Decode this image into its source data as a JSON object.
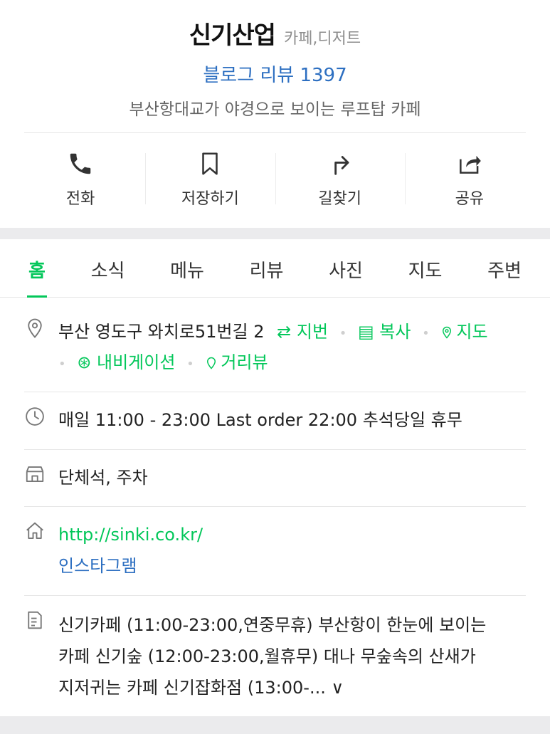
{
  "place": {
    "name": "신기산업",
    "category": "카페,디저트",
    "review_label": "블로그 리뷰 1397",
    "tagline": "부산항대교가 야경으로 보이는 루프탑 카페"
  },
  "actions": [
    {
      "label": "전화",
      "icon": "phone-icon"
    },
    {
      "label": "저장하기",
      "icon": "bookmark-icon"
    },
    {
      "label": "길찾기",
      "icon": "directions-icon"
    },
    {
      "label": "공유",
      "icon": "share-icon"
    }
  ],
  "tabs": [
    "홈",
    "소식",
    "메뉴",
    "리뷰",
    "사진",
    "지도",
    "주변"
  ],
  "active_tab": "홈",
  "address": {
    "text": "부산 영도구 와치로51번길 2",
    "links": [
      "지번",
      "복사",
      "지도",
      "내비게이션",
      "거리뷰"
    ]
  },
  "hours": "매일 11:00 - 23:00 Last order 22:00 추석당일 휴무",
  "facilities": "단체석, 주차",
  "homepage": {
    "url": "http://sinki.co.kr/",
    "instagram": "인스타그램"
  },
  "description": {
    "line1": "신기카페 (11:00-23:00,연중무휴) 부산항이 한눈에 보이는",
    "line2": "카페 신기숲 (12:00-23:00,월휴무) 대나 무숲속의 산새가",
    "line3": "지저귀는 카페 신기잡화점 (13:00-... ∨"
  },
  "colors": {
    "accent": "#03c75a",
    "link_blue": "#2d6fc1"
  }
}
